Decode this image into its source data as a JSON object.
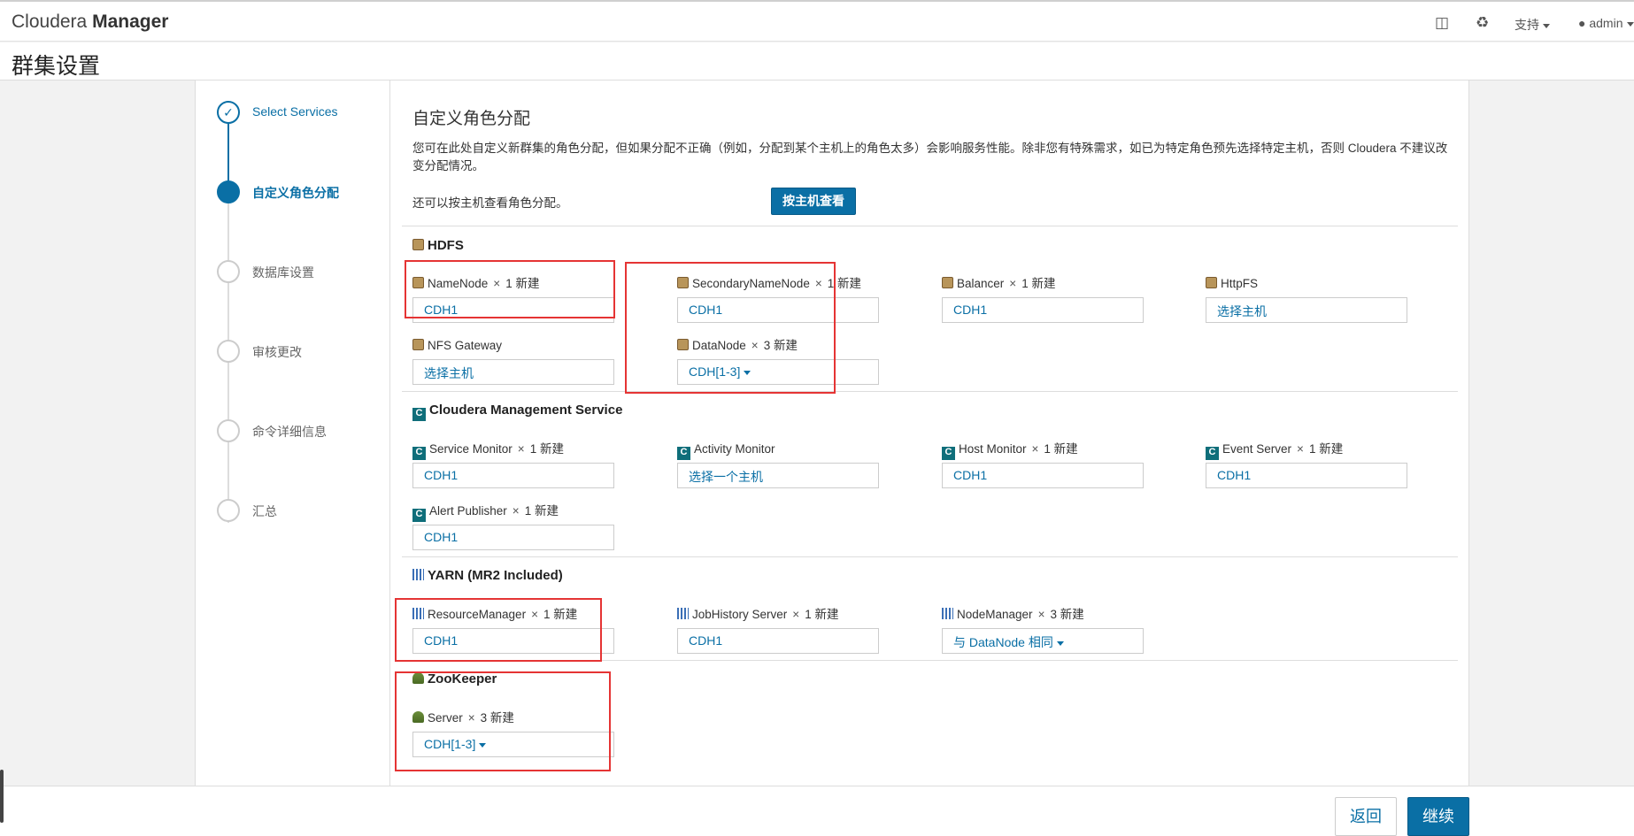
{
  "app": {
    "brand_light": "Cloudera",
    "brand_bold": "Manager"
  },
  "topnav": {
    "support_label": "支持",
    "user_label": "admin"
  },
  "page_title": "群集设置",
  "steps": [
    {
      "label": "Select Services",
      "state": "done"
    },
    {
      "label": "自定义角色分配",
      "state": "current"
    },
    {
      "label": "数据库设置",
      "state": "pending"
    },
    {
      "label": "审核更改",
      "state": "pending"
    },
    {
      "label": "命令详细信息",
      "state": "pending"
    },
    {
      "label": "汇总",
      "state": "pending"
    }
  ],
  "main": {
    "heading": "自定义角色分配",
    "description": "您可在此处自定义新群集的角色分配，但如果分配不正确（例如，分配到某个主机上的角色太多）会影响服务性能。除非您有特殊需求，如已为特定角色预先选择特定主机，否则 Cloudera 不建议改变分配情况。",
    "by_host_text": "还可以按主机查看角色分配。",
    "by_host_button": "按主机查看"
  },
  "services": {
    "hdfs": {
      "title": "HDFS",
      "roles": [
        {
          "name": "NameNode",
          "count": "1 新建",
          "host": "CDH1"
        },
        {
          "name": "SecondaryNameNode",
          "count": "1 新建",
          "host": "CDH1"
        },
        {
          "name": "Balancer",
          "count": "1 新建",
          "host": "CDH1"
        },
        {
          "name": "HttpFS",
          "count": "",
          "host": "选择主机"
        },
        {
          "name": "NFS Gateway",
          "count": "",
          "host": "选择主机"
        },
        {
          "name": "DataNode",
          "count": "3 新建",
          "host": "CDH[1-3]"
        }
      ]
    },
    "cms": {
      "title": "Cloudera Management Service",
      "roles": [
        {
          "name": "Service Monitor",
          "count": "1 新建",
          "host": "CDH1"
        },
        {
          "name": "Activity Monitor",
          "count": "",
          "host": "选择一个主机"
        },
        {
          "name": "Host Monitor",
          "count": "1 新建",
          "host": "CDH1"
        },
        {
          "name": "Event Server",
          "count": "1 新建",
          "host": "CDH1"
        },
        {
          "name": "Alert Publisher",
          "count": "1 新建",
          "host": "CDH1"
        }
      ]
    },
    "yarn": {
      "title": "YARN (MR2 Included)",
      "roles": [
        {
          "name": "ResourceManager",
          "count": "1 新建",
          "host": "CDH1"
        },
        {
          "name": "JobHistory Server",
          "count": "1 新建",
          "host": "CDH1"
        },
        {
          "name": "NodeManager",
          "count": "3 新建",
          "host": "与 DataNode 相同"
        }
      ]
    },
    "zookeeper": {
      "title": "ZooKeeper",
      "roles": [
        {
          "name": "Server",
          "count": "3 新建",
          "host": "CDH[1-3]"
        }
      ]
    }
  },
  "multiplier": "×",
  "footer": {
    "back_label": "返回",
    "continue_label": "继续"
  },
  "colors": {
    "accent": "#0a6fa5",
    "highlight": "#e53434"
  }
}
